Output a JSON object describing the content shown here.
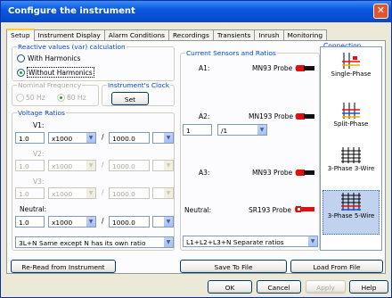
{
  "window": {
    "title": "Configure the instrument"
  },
  "tabs": [
    {
      "label": "Setup",
      "active": true
    },
    {
      "label": "Instrument Display"
    },
    {
      "label": "Alarm Conditions"
    },
    {
      "label": "Recordings"
    },
    {
      "label": "Transients"
    },
    {
      "label": "Inrush"
    },
    {
      "label": "Monitoring"
    }
  ],
  "reactive": {
    "title": "Reactive values (var) calculation",
    "with": "With Harmonics",
    "without": "Without Harmonics"
  },
  "nominal": {
    "title": "Nominal Frequency",
    "hz50": "50 Hz",
    "hz60": "60 Hz"
  },
  "clock": {
    "title": "Instrument's Clock",
    "set": "Set"
  },
  "voltage": {
    "title": "Voltage Ratios",
    "v1": {
      "label": "V1:",
      "primary": "1.0",
      "mult": "x1000",
      "secondary": "1000.0",
      "unit": ""
    },
    "v2": {
      "label": "V2:",
      "primary": "1.0",
      "mult": "x1000",
      "secondary": "1000.0",
      "unit": ""
    },
    "v3": {
      "label": "V3:",
      "primary": "1.0",
      "mult": "x1000",
      "secondary": "1000.0",
      "unit": ""
    },
    "neutral": {
      "label": "Neutral:",
      "primary": "1.0",
      "mult": "x1000",
      "secondary": "1000.0",
      "unit": ""
    },
    "slash": "/",
    "mode": "3L+N Same except N has its own ratio"
  },
  "sensors": {
    "title": "Current Sensors and Ratios",
    "a1": {
      "label": "A1:",
      "probe": "MN93 Probe"
    },
    "a2": {
      "label": "A2:",
      "probe": "MN193 Probe",
      "ratio_value": "1",
      "ratio_select": "/1"
    },
    "a3": {
      "label": "A3:",
      "probe": "MN93 Probe"
    },
    "neutral": {
      "label": "Neutral:",
      "probe": "SR193 Probe"
    },
    "mode": "L1+L2+L3+N Separate ratios"
  },
  "connection": {
    "title": "Connection",
    "items": [
      {
        "label": "Single-Phase"
      },
      {
        "label": "Split-Phase"
      },
      {
        "label": "3-Phase 3-Wire"
      },
      {
        "label": "3-Phase 5-Wire",
        "selected": true
      }
    ]
  },
  "bottom": {
    "reread": "Re-Read from Instrument",
    "save": "Save To File",
    "load": "Load From File"
  },
  "footer": {
    "ok": "OK",
    "cancel": "Cancel",
    "apply": "Apply",
    "help": "Help"
  },
  "colors": {
    "title_bar": "#0A58E0",
    "group_title": "#0046D5",
    "probe_red": "#E01010"
  }
}
